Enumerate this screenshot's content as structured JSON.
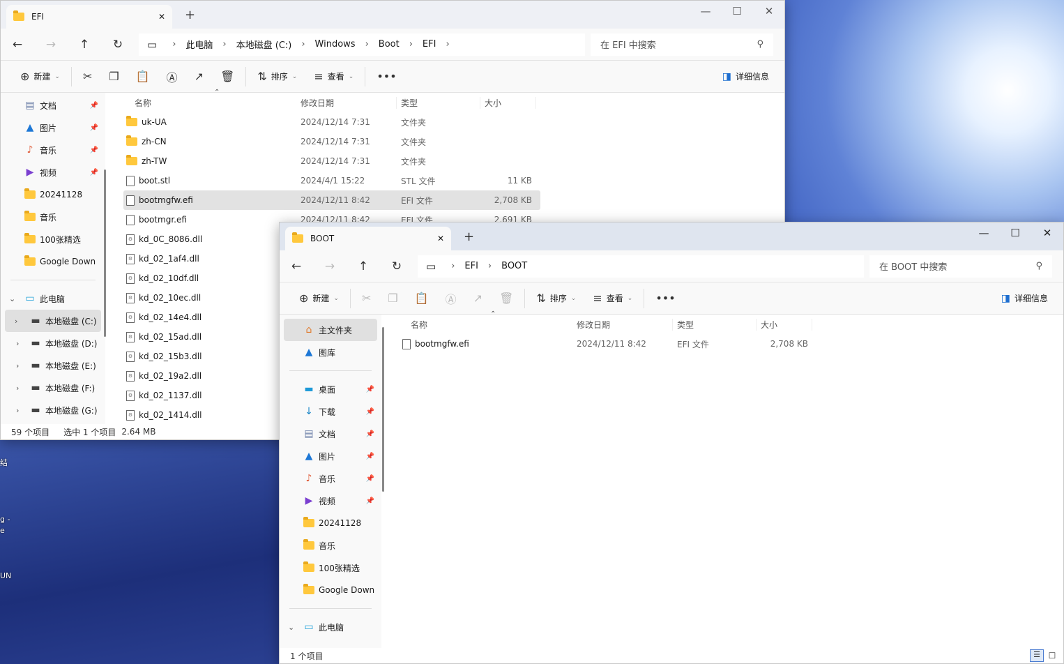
{
  "desktop_fragments": [
    "结",
    "g -",
    "e",
    "UN"
  ],
  "win1": {
    "tab_title": "EFI",
    "breadcrumbs": [
      "此电脑",
      "本地磁盘 (C:)",
      "Windows",
      "Boot",
      "EFI"
    ],
    "search_placeholder": "在 EFI 中搜索",
    "toolbar": {
      "new": "新建",
      "sort": "排序",
      "view": "查看",
      "more": "…",
      "details": "详细信息"
    },
    "sidebar": [
      {
        "label": "文档",
        "icon": "documents-icon",
        "pinned": true
      },
      {
        "label": "图片",
        "icon": "pictures-icon",
        "pinned": true
      },
      {
        "label": "音乐",
        "icon": "music-icon",
        "pinned": true
      },
      {
        "label": "视频",
        "icon": "videos-icon",
        "pinned": true
      },
      {
        "label": "20241128",
        "icon": "folder-icon"
      },
      {
        "label": "音乐",
        "icon": "folder-icon"
      },
      {
        "label": "100张精选",
        "icon": "folder-icon"
      },
      {
        "label": "Google Down",
        "icon": "folder-icon"
      },
      {
        "sep": true
      },
      {
        "label": "此电脑",
        "icon": "this-pc-icon",
        "expanded": true,
        "level": 0
      },
      {
        "label": "本地磁盘 (C:)",
        "icon": "drive-icon",
        "level": 1,
        "selected": true
      },
      {
        "label": "本地磁盘 (D:)",
        "icon": "drive-icon",
        "level": 1
      },
      {
        "label": "本地磁盘 (E:)",
        "icon": "drive-icon",
        "level": 1
      },
      {
        "label": "本地磁盘 (F:)",
        "icon": "drive-icon",
        "level": 1
      },
      {
        "label": "本地磁盘 (G:)",
        "icon": "drive-icon",
        "level": 1
      }
    ],
    "columns": [
      "名称",
      "修改日期",
      "类型",
      "大小"
    ],
    "files": [
      {
        "name": "uk-UA",
        "date": "2024/12/14 7:31",
        "type": "文件夹",
        "size": "",
        "kind": "folder"
      },
      {
        "name": "zh-CN",
        "date": "2024/12/14 7:31",
        "type": "文件夹",
        "size": "",
        "kind": "folder"
      },
      {
        "name": "zh-TW",
        "date": "2024/12/14 7:31",
        "type": "文件夹",
        "size": "",
        "kind": "folder"
      },
      {
        "name": "boot.stl",
        "date": "2024/4/1 15:22",
        "type": "STL 文件",
        "size": "11 KB",
        "kind": "file"
      },
      {
        "name": "bootmgfw.efi",
        "date": "2024/12/11 8:42",
        "type": "EFI 文件",
        "size": "2,708 KB",
        "kind": "file",
        "selected": true
      },
      {
        "name": "bootmgr.efi",
        "date": "2024/12/11 8:42",
        "type": "EFI 文件",
        "size": "2,691 KB",
        "kind": "file"
      },
      {
        "name": "kd_0C_8086.dll",
        "kind": "dll"
      },
      {
        "name": "kd_02_1af4.dll",
        "kind": "dll"
      },
      {
        "name": "kd_02_10df.dll",
        "kind": "dll"
      },
      {
        "name": "kd_02_10ec.dll",
        "kind": "dll"
      },
      {
        "name": "kd_02_14e4.dll",
        "kind": "dll"
      },
      {
        "name": "kd_02_15ad.dll",
        "kind": "dll"
      },
      {
        "name": "kd_02_15b3.dll",
        "kind": "dll"
      },
      {
        "name": "kd_02_19a2.dll",
        "kind": "dll"
      },
      {
        "name": "kd_02_1137.dll",
        "kind": "dll"
      },
      {
        "name": "kd_02_1414.dll",
        "kind": "dll"
      }
    ],
    "status": {
      "count": "59 个项目",
      "selected": "选中 1 个项目",
      "size": "2.64 MB"
    }
  },
  "win2": {
    "tab_title": "BOOT",
    "breadcrumbs": [
      "EFI",
      "BOOT"
    ],
    "search_placeholder": "在 BOOT 中搜索",
    "toolbar": {
      "new": "新建",
      "sort": "排序",
      "view": "查看",
      "more": "…",
      "details": "详细信息"
    },
    "sidebar": [
      {
        "label": "主文件夹",
        "icon": "home-icon",
        "selected": true
      },
      {
        "label": "图库",
        "icon": "gallery-icon"
      },
      {
        "sep": true
      },
      {
        "label": "桌面",
        "icon": "desktop-icon",
        "pinned": true
      },
      {
        "label": "下载",
        "icon": "downloads-icon",
        "pinned": true
      },
      {
        "label": "文档",
        "icon": "documents-icon",
        "pinned": true
      },
      {
        "label": "图片",
        "icon": "pictures-icon",
        "pinned": true
      },
      {
        "label": "音乐",
        "icon": "music-icon",
        "pinned": true
      },
      {
        "label": "视频",
        "icon": "videos-icon",
        "pinned": true
      },
      {
        "label": "20241128",
        "icon": "folder-icon"
      },
      {
        "label": "音乐",
        "icon": "folder-icon"
      },
      {
        "label": "100张精选",
        "icon": "folder-icon"
      },
      {
        "label": "Google Down",
        "icon": "folder-icon"
      },
      {
        "sep": true
      },
      {
        "label": "此电脑",
        "icon": "this-pc-icon",
        "expanded": true,
        "level": 0
      }
    ],
    "columns": [
      "名称",
      "修改日期",
      "类型",
      "大小"
    ],
    "files": [
      {
        "name": "bootmgfw.efi",
        "date": "2024/12/11 8:42",
        "type": "EFI 文件",
        "size": "2,708 KB",
        "kind": "file"
      }
    ],
    "status": {
      "count": "1 个项目"
    }
  }
}
